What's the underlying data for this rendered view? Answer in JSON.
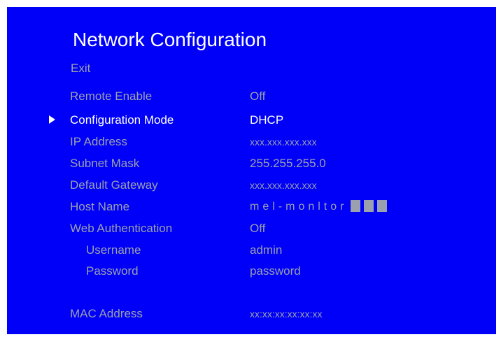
{
  "title": "Network Configuration",
  "exit_label": "Exit",
  "colors": {
    "background": "#0000f8",
    "text_dim": "#9aa0ae",
    "text_selected": "#ffffff"
  },
  "selected_item": "Configuration Mode",
  "settings": [
    {
      "label": "Remote Enable",
      "value": "Off"
    },
    {
      "label": "Configuration Mode",
      "value": "DHCP"
    },
    {
      "label": "IP Address",
      "value": "xxx.xxx.xxx.xxx"
    },
    {
      "label": "Subnet Mask",
      "value": "255.255.255.0"
    },
    {
      "label": "Default Gateway",
      "value": "xxx.xxx.xxx.xxx"
    },
    {
      "label": "Host Name",
      "value": "mel-monltor"
    },
    {
      "label": "Web Authentication",
      "value": "Off"
    },
    {
      "label": "Username",
      "value": "admin"
    },
    {
      "label": "Password",
      "value": "password"
    },
    {
      "label": "MAC Address",
      "value": "xx:xx:xx:xx:xx:xx"
    }
  ]
}
